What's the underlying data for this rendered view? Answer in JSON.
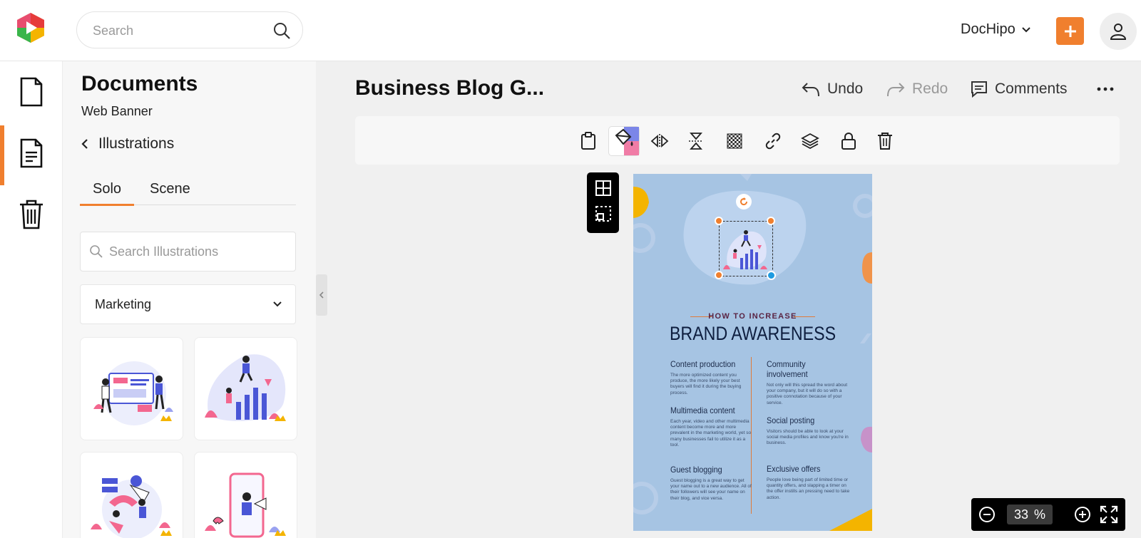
{
  "header": {
    "search_placeholder": "Search",
    "brand_label": "DocHipo"
  },
  "rail": {
    "items": [
      "documents-icon",
      "templates-icon",
      "trash-icon"
    ]
  },
  "panel": {
    "title": "Documents",
    "subtitle": "Web Banner",
    "back_label": "Illustrations",
    "tabs": [
      {
        "label": "Solo",
        "active": true
      },
      {
        "label": "Scene",
        "active": false
      }
    ],
    "search_placeholder": "Search Illustrations",
    "category": "Marketing"
  },
  "editor": {
    "doc_title": "Business Blog G...",
    "undo_label": "Undo",
    "redo_label": "Redo",
    "comments_label": "Comments",
    "zoom_value": "33",
    "zoom_unit": "%"
  },
  "poster": {
    "kicker": "HOW TO INCREASE",
    "headline": "BRAND AWARENESS",
    "sections": [
      {
        "title": "Content production",
        "body": "The more optimized content you produce, the more likely your best buyers will find it during the buying process."
      },
      {
        "title": "Community involvement",
        "body": "Not only will this spread the word about your company, but it will do so with a positive connotation because of your service."
      },
      {
        "title": "Multimedia content",
        "body": "Each year, video and other multimedia content become more and more prevalent in the marketing world, yet so many businesses fail to utilize it as a tool."
      },
      {
        "title": "Social posting",
        "body": "Visitors should be able to look at your social media profiles and know you're in business."
      },
      {
        "title": "Guest blogging",
        "body": "Guest blogging is a great way to get your name out to a new audience. All of their followers will see your name on their blog, and vice versa."
      },
      {
        "title": "Exclusive offers",
        "body": "People love being part of limited time or quantity offers, and slapping a timer on the offer instills an pressing need to take action."
      }
    ]
  },
  "colors": {
    "accent": "#f07f2e",
    "poster_bg": "#a6c4e3",
    "selection_blue": "#1e9be0"
  }
}
